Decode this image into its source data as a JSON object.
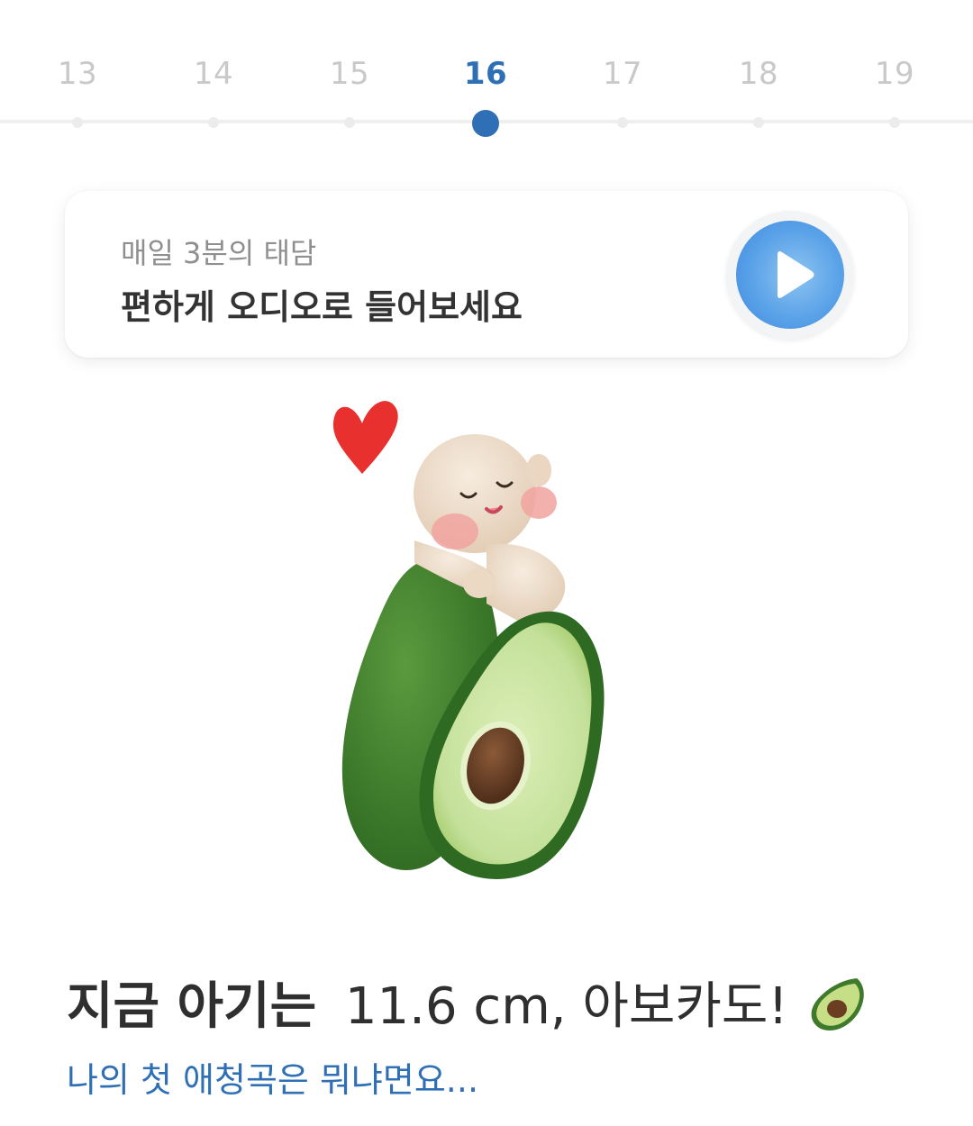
{
  "weeks": {
    "items": [
      "13",
      "14",
      "15",
      "16",
      "17",
      "18",
      "19"
    ],
    "selected": "16"
  },
  "audio_card": {
    "subtitle": "매일 3분의 태담",
    "title": "편하게 오디오로 들어보세요",
    "play_icon": "play-icon"
  },
  "illustration": {
    "subject": "baby-hugging-avocado",
    "heart_icon": "heart-icon"
  },
  "summary": {
    "lead": "지금 아기는",
    "detail": "11.6 cm, 아보카도!",
    "emoji_icon": "avocado-icon",
    "link": "나의 첫 애청곡은 뭐냐면요..."
  },
  "colors": {
    "accent": "#2f6fb5",
    "inactive_week": "#c9c9c9",
    "play_button": "#5aa2e8",
    "heart": "#e8302f",
    "avocado_skin": "#3f7a2c",
    "avocado_flesh": "#cfe6a6"
  }
}
